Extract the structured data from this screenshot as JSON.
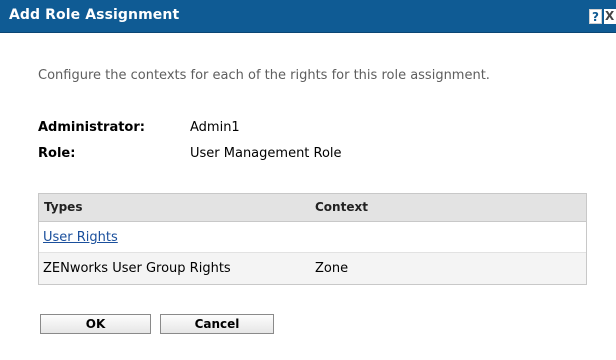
{
  "dialog": {
    "title": "Add Role Assignment",
    "help_glyph": "?",
    "close_glyph": "X"
  },
  "intro_text": "Configure the contexts for each of the rights for this role assignment.",
  "fields": {
    "administrator_label": "Administrator:",
    "administrator_value": "Admin1",
    "role_label": "Role:",
    "role_value": "User Management Role"
  },
  "table": {
    "columns": [
      "Types",
      "Context"
    ],
    "rows": [
      {
        "type": "User Rights",
        "context": ""
      },
      {
        "type": "ZENworks User Group Rights",
        "context": "Zone"
      }
    ]
  },
  "buttons": {
    "ok": "OK",
    "cancel": "Cancel"
  },
  "colors": {
    "titlebar": "#0f5b94",
    "header_bg": "#e3e3e3",
    "link": "#1a4f9c"
  }
}
